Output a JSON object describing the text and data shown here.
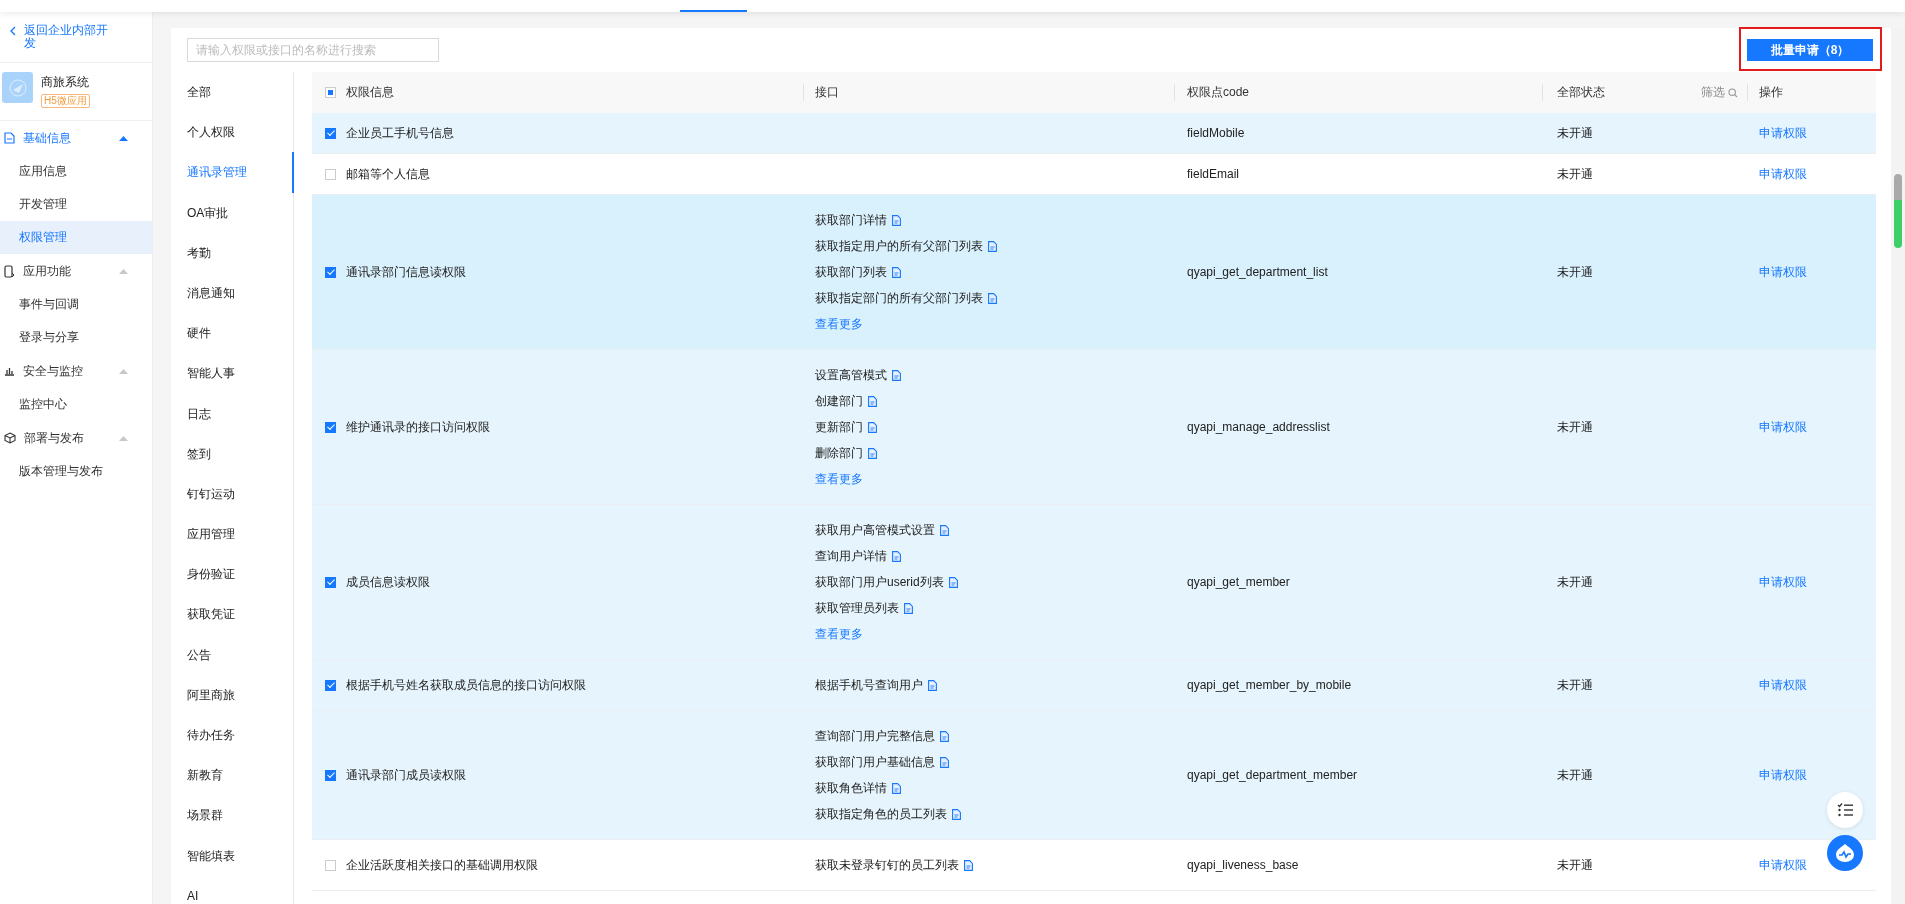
{
  "sidebar": {
    "back_link": "返回企业内部开发",
    "app": {
      "name": "商旅系统",
      "badge": "H5微应用"
    },
    "groups": [
      {
        "label": "基础信息",
        "expanded": true,
        "items": [
          {
            "label": "应用信息",
            "selected": false
          },
          {
            "label": "开发管理",
            "selected": false
          },
          {
            "label": "权限管理",
            "selected": true
          }
        ]
      },
      {
        "label": "应用功能",
        "expanded": true,
        "items": [
          {
            "label": "事件与回调",
            "selected": false
          },
          {
            "label": "登录与分享",
            "selected": false
          }
        ]
      },
      {
        "label": "安全与监控",
        "expanded": true,
        "items": [
          {
            "label": "监控中心",
            "selected": false
          }
        ]
      },
      {
        "label": "部署与发布",
        "expanded": true,
        "items": [
          {
            "label": "版本管理与发布",
            "selected": false
          }
        ]
      }
    ]
  },
  "search": {
    "placeholder": "请输入权限或接口的名称进行搜索"
  },
  "batch_button": {
    "label": "批量申请（8）",
    "annotated": true
  },
  "categories": [
    {
      "label": "全部",
      "selected": false
    },
    {
      "label": "个人权限",
      "selected": false
    },
    {
      "label": "通讯录管理",
      "selected": true
    },
    {
      "label": "OA审批",
      "selected": false
    },
    {
      "label": "考勤",
      "selected": false
    },
    {
      "label": "消息通知",
      "selected": false
    },
    {
      "label": "硬件",
      "selected": false
    },
    {
      "label": "智能人事",
      "selected": false
    },
    {
      "label": "日志",
      "selected": false
    },
    {
      "label": "签到",
      "selected": false
    },
    {
      "label": "钉钉运动",
      "selected": false
    },
    {
      "label": "应用管理",
      "selected": false
    },
    {
      "label": "身份验证",
      "selected": false
    },
    {
      "label": "获取凭证",
      "selected": false
    },
    {
      "label": "公告",
      "selected": false
    },
    {
      "label": "阿里商旅",
      "selected": false
    },
    {
      "label": "待办任务",
      "selected": false
    },
    {
      "label": "新教育",
      "selected": false
    },
    {
      "label": "场景群",
      "selected": false
    },
    {
      "label": "智能填表",
      "selected": false
    },
    {
      "label": "AI",
      "selected": false
    }
  ],
  "table": {
    "select_all": {
      "indeterminate": true
    },
    "columns": [
      "权限信息",
      "接口",
      "权限点code",
      "全部状态",
      "操作"
    ],
    "filter_label": "筛选",
    "rows": [
      {
        "checked": true,
        "hovered": false,
        "name": "企业员工手机号信息",
        "apis": [],
        "code": "fieldMobile",
        "status": "未开通",
        "action": "申请权限"
      },
      {
        "checked": false,
        "hovered": false,
        "name": "邮箱等个人信息",
        "apis": [],
        "code": "fieldEmail",
        "status": "未开通",
        "action": "申请权限"
      },
      {
        "checked": true,
        "hovered": true,
        "name": "通讯录部门信息读权限",
        "apis": [
          "获取部门详情",
          "获取指定用户的所有父部门列表",
          "获取部门列表",
          "获取指定部门的所有父部门列表"
        ],
        "more": "查看更多",
        "code": "qyapi_get_department_list",
        "status": "未开通",
        "action": "申请权限"
      },
      {
        "checked": true,
        "hovered": false,
        "name": "维护通讯录的接口访问权限",
        "apis": [
          "设置高管模式",
          "创建部门",
          "更新部门",
          "删除部门"
        ],
        "more": "查看更多",
        "code": "qyapi_manage_addresslist",
        "status": "未开通",
        "action": "申请权限"
      },
      {
        "checked": true,
        "hovered": false,
        "name": "成员信息读权限",
        "apis": [
          "获取用户高管模式设置",
          "查询用户详情",
          "获取部门用户userid列表",
          "获取管理员列表"
        ],
        "more": "查看更多",
        "code": "qyapi_get_member",
        "status": "未开通",
        "action": "申请权限"
      },
      {
        "checked": true,
        "hovered": false,
        "name": "根据手机号姓名获取成员信息的接口访问权限",
        "apis": [
          "根据手机号查询用户"
        ],
        "code": "qyapi_get_member_by_mobile",
        "status": "未开通",
        "action": "申请权限"
      },
      {
        "checked": true,
        "hovered": false,
        "name": "通讯录部门成员读权限",
        "apis": [
          "查询部门用户完整信息",
          "获取部门用户基础信息",
          "获取角色详情",
          "获取指定角色的员工列表"
        ],
        "code": "qyapi_get_department_member",
        "status": "未开通",
        "action": "申请权限"
      },
      {
        "checked": false,
        "hovered": false,
        "name": "企业活跃度相关接口的基础调用权限",
        "apis": [
          "获取未登录钉钉的员工列表"
        ],
        "code": "qyapi_liveness_base",
        "status": "未开通",
        "action": "申请权限"
      }
    ]
  }
}
